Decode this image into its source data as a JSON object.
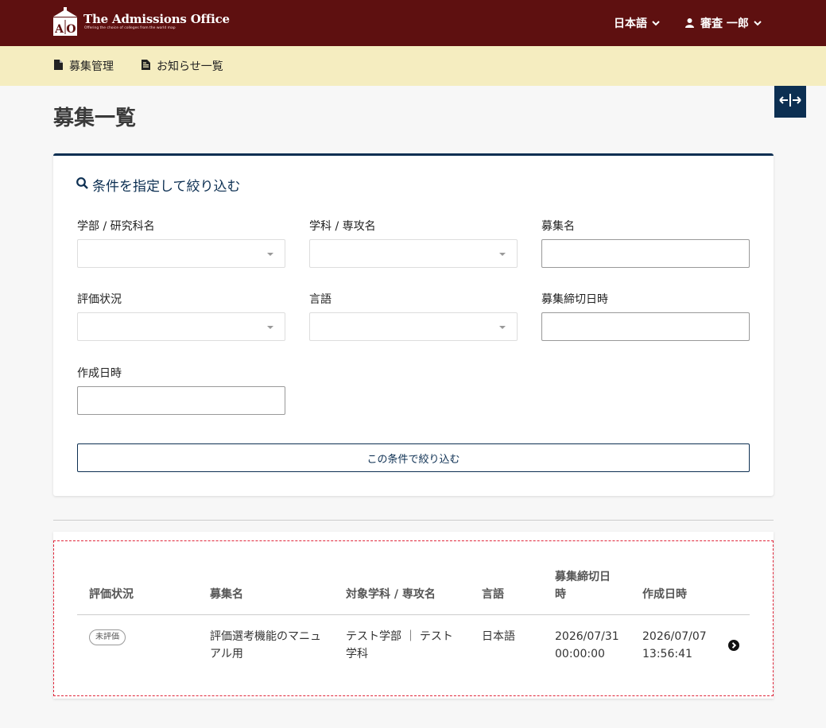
{
  "header": {
    "logo_title": "The Admissions Office",
    "logo_subtitle": "Offering the choice of colleges from the world map",
    "logo_mark": "AO",
    "language_label": "日本語",
    "user_label": "審査 一郎"
  },
  "subnav": {
    "items": [
      {
        "label": "募集管理",
        "icon": "file-icon"
      },
      {
        "label": "お知らせ一覧",
        "icon": "document-icon"
      }
    ]
  },
  "page": {
    "title": "募集一覧"
  },
  "filter": {
    "heading": "条件を指定して絞り込む",
    "fields": {
      "faculty": {
        "label": "学部 / 研究科名",
        "value": ""
      },
      "department": {
        "label": "学科 / 専攻名",
        "value": ""
      },
      "recruit_name": {
        "label": "募集名",
        "value": ""
      },
      "evaluation_status": {
        "label": "評価状況",
        "value": ""
      },
      "language": {
        "label": "言語",
        "value": ""
      },
      "deadline": {
        "label": "募集締切日時",
        "value": ""
      },
      "created_at": {
        "label": "作成日時",
        "value": ""
      }
    },
    "submit_label": "この条件で絞り込む"
  },
  "table": {
    "headers": {
      "status": "評価状況",
      "name": "募集名",
      "dept": "対象学科 / 専攻名",
      "lang": "言語",
      "deadline_line1": "募集締切日",
      "deadline_line2": "時",
      "created": "作成日時"
    },
    "rows": [
      {
        "status": "未評価",
        "name_line1": "評価選考機能のマニュ",
        "name_line2": "アル用",
        "dept_line1": "テスト学部 ｜ テスト",
        "dept_line2": "学科",
        "lang": "日本語",
        "deadline_line1": "2026/07/31",
        "deadline_line2": "00:00:00",
        "created_line1": "2026/07/07",
        "created_line2": "13:56:41"
      }
    ]
  },
  "colors": {
    "header_bg": "#5e1010",
    "subnav_bg": "#f5edc0",
    "accent": "#0c2f52",
    "dashed_border": "#e0263a"
  }
}
